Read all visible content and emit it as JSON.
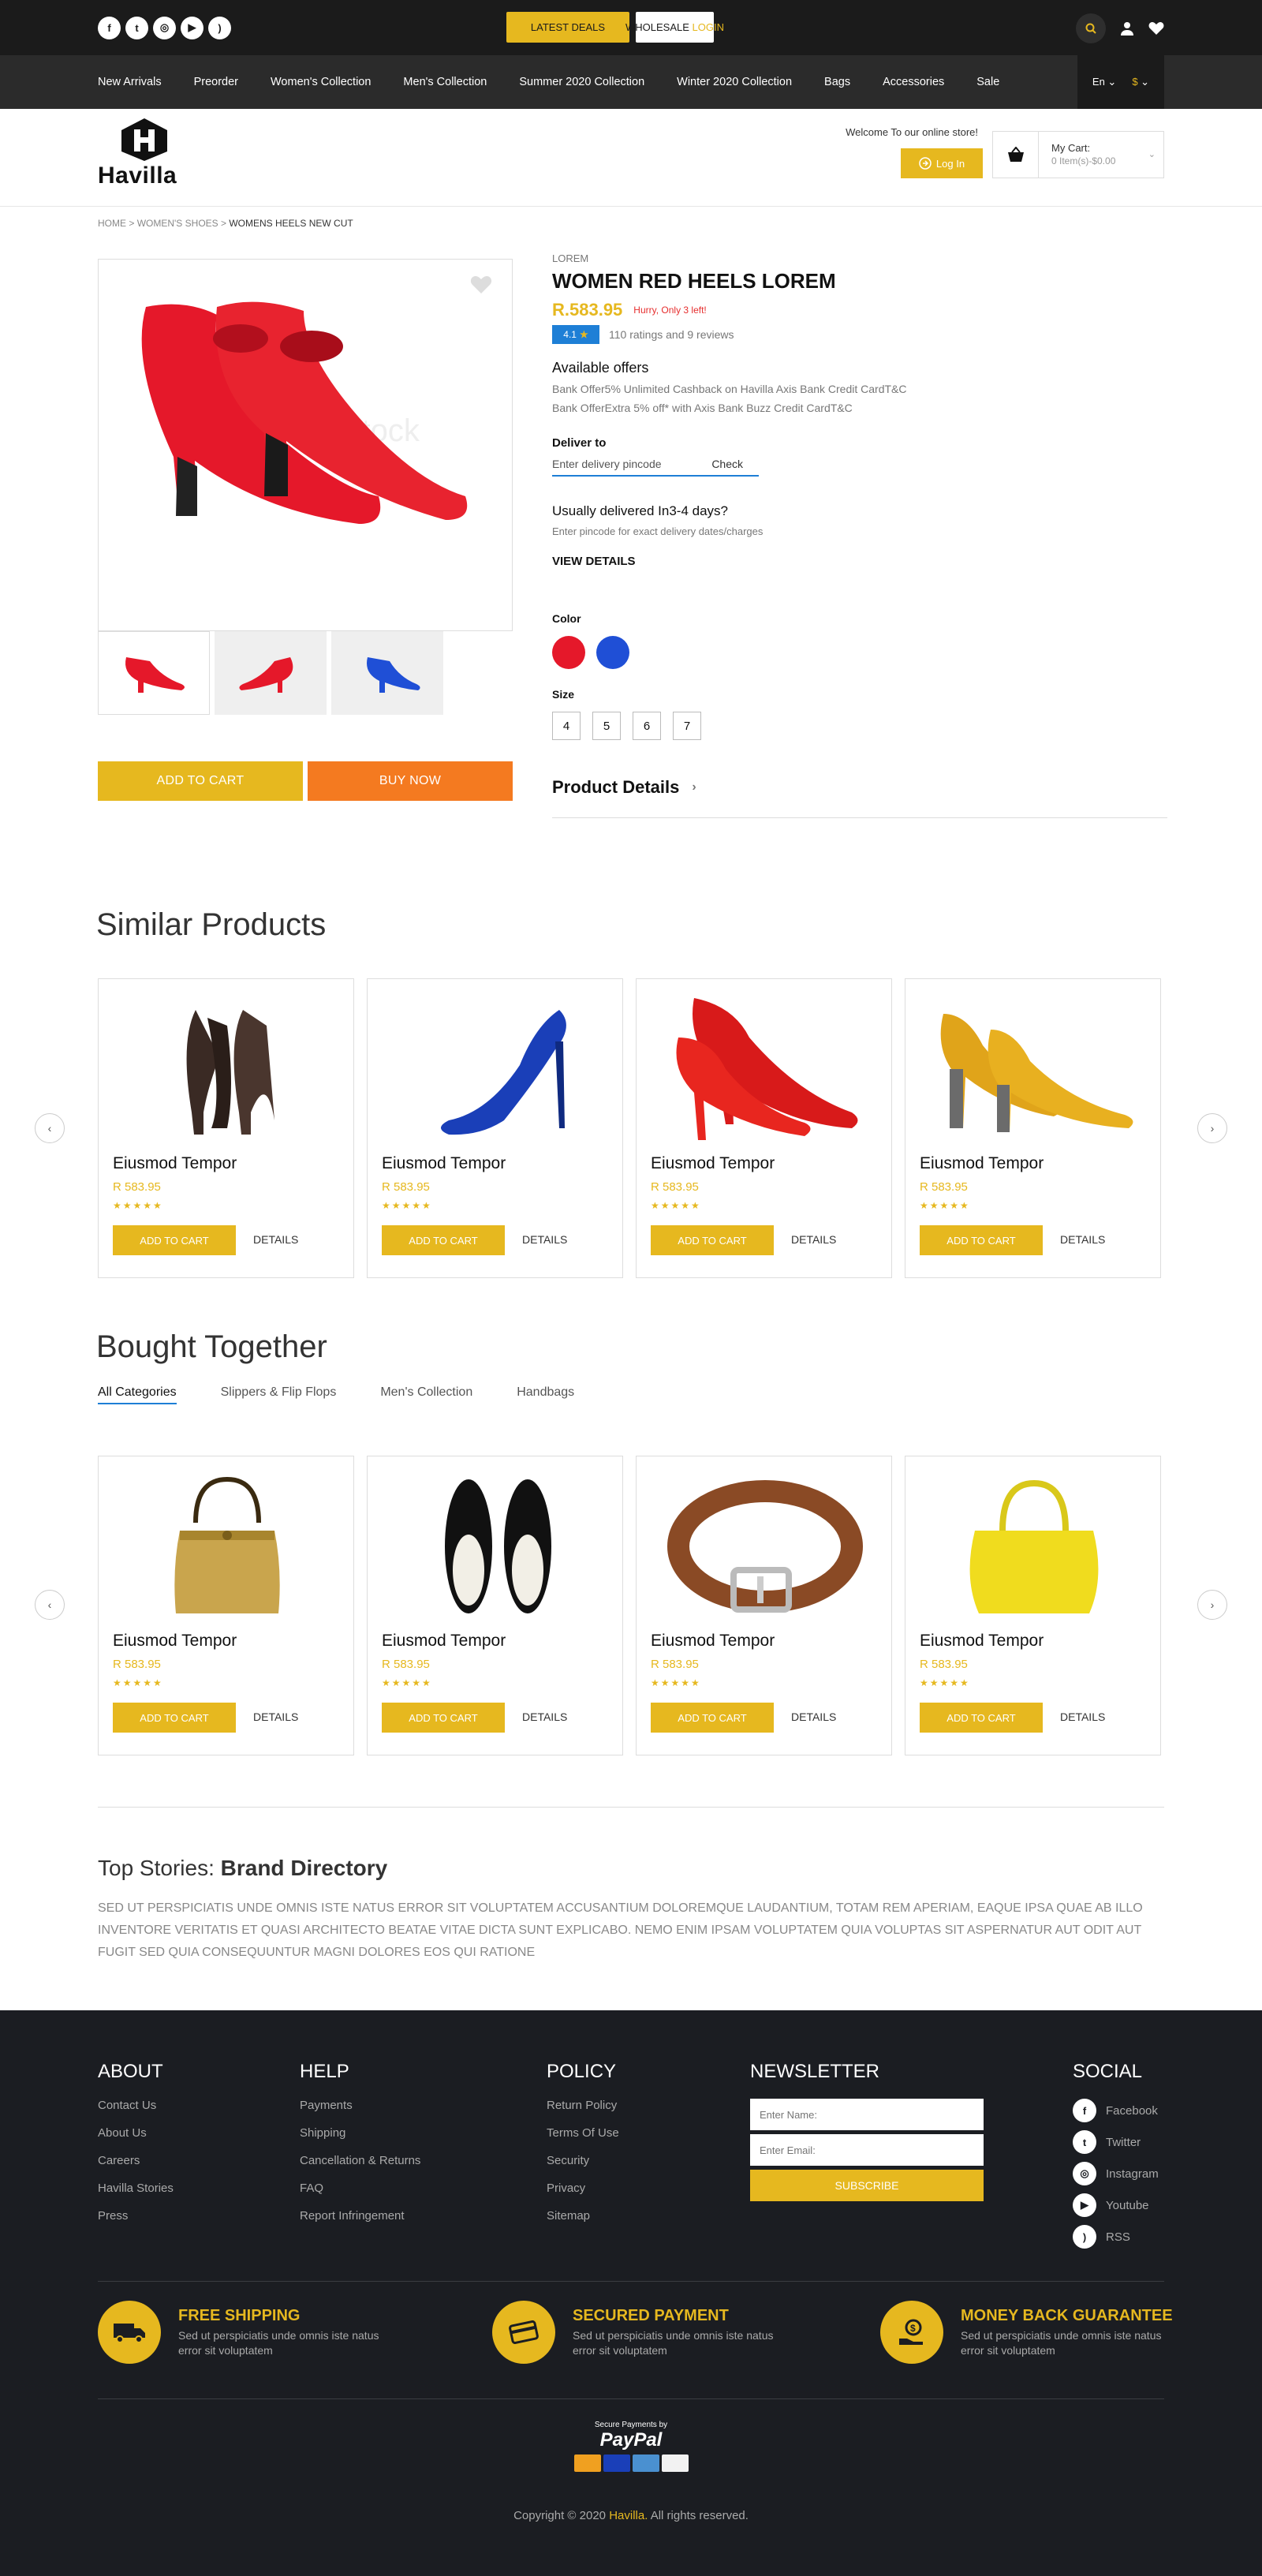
{
  "topbar": {
    "social": [
      "f",
      "t",
      "ig",
      "yt",
      "rss"
    ],
    "latest_deals": "LATEST DEALS",
    "wholesale": "WHOLESALE",
    "login_word": "LOGIN"
  },
  "nav": {
    "items": [
      "New Arrivals",
      "Preorder",
      "Women's Collection",
      "Men's Collection",
      "Summer 2020 Collection",
      "Winter 2020 Collection",
      "Bags",
      "Accessories",
      "Sale"
    ],
    "lang": "En",
    "currency": "$"
  },
  "header": {
    "logo_text": "Havilla",
    "welcome": "Welcome To our online store!",
    "login": "Log In",
    "cart_label": "My Cart:",
    "cart_items": "0 Item(s)-$0.00"
  },
  "breadcrumb": {
    "home": "HOME",
    "section": "WOMEN'S SHOES",
    "current": "WOMENS HEELS NEW CUT"
  },
  "product": {
    "brand": "LOREM",
    "title": "WOMEN RED HEELS LOREM",
    "price": "R.583.95",
    "stock_note": "Hurry, Only 3 left!",
    "rating": "4.1",
    "rating_text": "110 ratings and 9 reviews",
    "offers_heading": "Available offers",
    "offers": [
      "Bank Offer5% Unlimited Cashback on Havilla Axis Bank Credit CardT&C",
      "Bank OfferExtra 5% off* with Axis Bank Buzz Credit CardT&C"
    ],
    "deliver_heading": "Deliver to",
    "pincode_placeholder": "Enter delivery pincode",
    "check": "Check",
    "usually": "Usually delivered In3-4 days?",
    "usually_sub": "Enter pincode for exact delivery dates/charges",
    "view_details": "VIEW DETAILS",
    "color_heading": "Color",
    "colors": [
      "#e5182a",
      "#1f4fd6"
    ],
    "size_heading": "Size",
    "sizes": [
      "4",
      "5",
      "6",
      "7"
    ],
    "add_to_cart": "ADD TO CART",
    "buy_now": "BUY NOW",
    "product_details": "Product Details",
    "watermark": "Adobe Stock"
  },
  "similar": {
    "title": "Similar Products",
    "items": [
      {
        "name": "Eiusmod Tempor",
        "price": "R 583.95",
        "icon": "black-heel"
      },
      {
        "name": "Eiusmod Tempor",
        "price": "R 583.95",
        "icon": "blue-heel"
      },
      {
        "name": "Eiusmod Tempor",
        "price": "R 583.95",
        "icon": "red-heel"
      },
      {
        "name": "Eiusmod Tempor",
        "price": "R 583.95",
        "icon": "yellow-heel"
      }
    ],
    "add": "ADD TO CART",
    "details": "DETAILS",
    "stars": "★★★★★"
  },
  "bought": {
    "title": "Bought Together",
    "tabs": [
      "All Categories",
      "Slippers & Flip Flops",
      "Men's Collection",
      "Handbags"
    ],
    "items": [
      {
        "name": "Eiusmod Tempor",
        "price": "R 583.95",
        "icon": "gold-bag"
      },
      {
        "name": "Eiusmod Tempor",
        "price": "R 583.95",
        "icon": "black-flats"
      },
      {
        "name": "Eiusmod Tempor",
        "price": "R 583.95",
        "icon": "belt"
      },
      {
        "name": "Eiusmod Tempor",
        "price": "R 583.95",
        "icon": "yellow-bag"
      }
    ],
    "add": "ADD TO CART",
    "details": "DETAILS",
    "stars": "★★★★★"
  },
  "stories": {
    "prefix": "Top Stories: ",
    "title": "Brand Directory",
    "text": "SED UT PERSPICIATIS UNDE OMNIS ISTE NATUS ERROR SIT VOLUPTATEM ACCUSANTIUM DOLOREMQUE LAUDANTIUM, TOTAM REM APERIAM, EAQUE IPSA QUAE AB ILLO INVENTORE VERITATIS ET QUASI ARCHITECTO BEATAE VITAE DICTA SUNT EXPLICABO. NEMO ENIM IPSAM VOLUPTATEM QUIA VOLUPTAS SIT ASPERNATUR AUT ODIT AUT FUGIT SED QUIA CONSEQUUNTUR MAGNI DOLORES EOS QUI RATIONE"
  },
  "footer": {
    "about": {
      "title": "ABOUT",
      "links": [
        "Contact Us",
        "About Us",
        "Careers",
        "Havilla Stories",
        "Press"
      ]
    },
    "help": {
      "title": "HELP",
      "links": [
        "Payments",
        "Shipping",
        "Cancellation & Returns",
        "FAQ",
        "Report Infringement"
      ]
    },
    "policy": {
      "title": "POLICY",
      "links": [
        "Return Policy",
        "Terms Of Use",
        "Security",
        "Privacy",
        "Sitemap"
      ]
    },
    "newsletter": {
      "title": "NEWSLETTER",
      "name_ph": "Enter Name:",
      "email_ph": "Enter Email:",
      "subscribe": "SUBSCRIBE"
    },
    "social": {
      "title": "SOCIAL",
      "links": [
        "Facebook",
        "Twitter",
        "Instagram",
        "Youtube",
        "RSS"
      ]
    },
    "features": [
      {
        "title": "FREE SHIPPING",
        "text": "Sed ut perspiciatis unde omnis iste natus error sit voluptatem"
      },
      {
        "title": "SECURED PAYMENT",
        "text": "Sed ut perspiciatis unde omnis iste natus error sit voluptatem"
      },
      {
        "title": "MONEY BACK GUARANTEE",
        "text": "Sed ut perspiciatis unde omnis iste natus error sit voluptatem"
      }
    ],
    "secure_payments": "Secure Payments by",
    "paypal": "PayPal",
    "copyright_pre": "Copyright © 2020 ",
    "copyright_brand": "Havilla.",
    "copyright_post": " All rights reserved."
  }
}
